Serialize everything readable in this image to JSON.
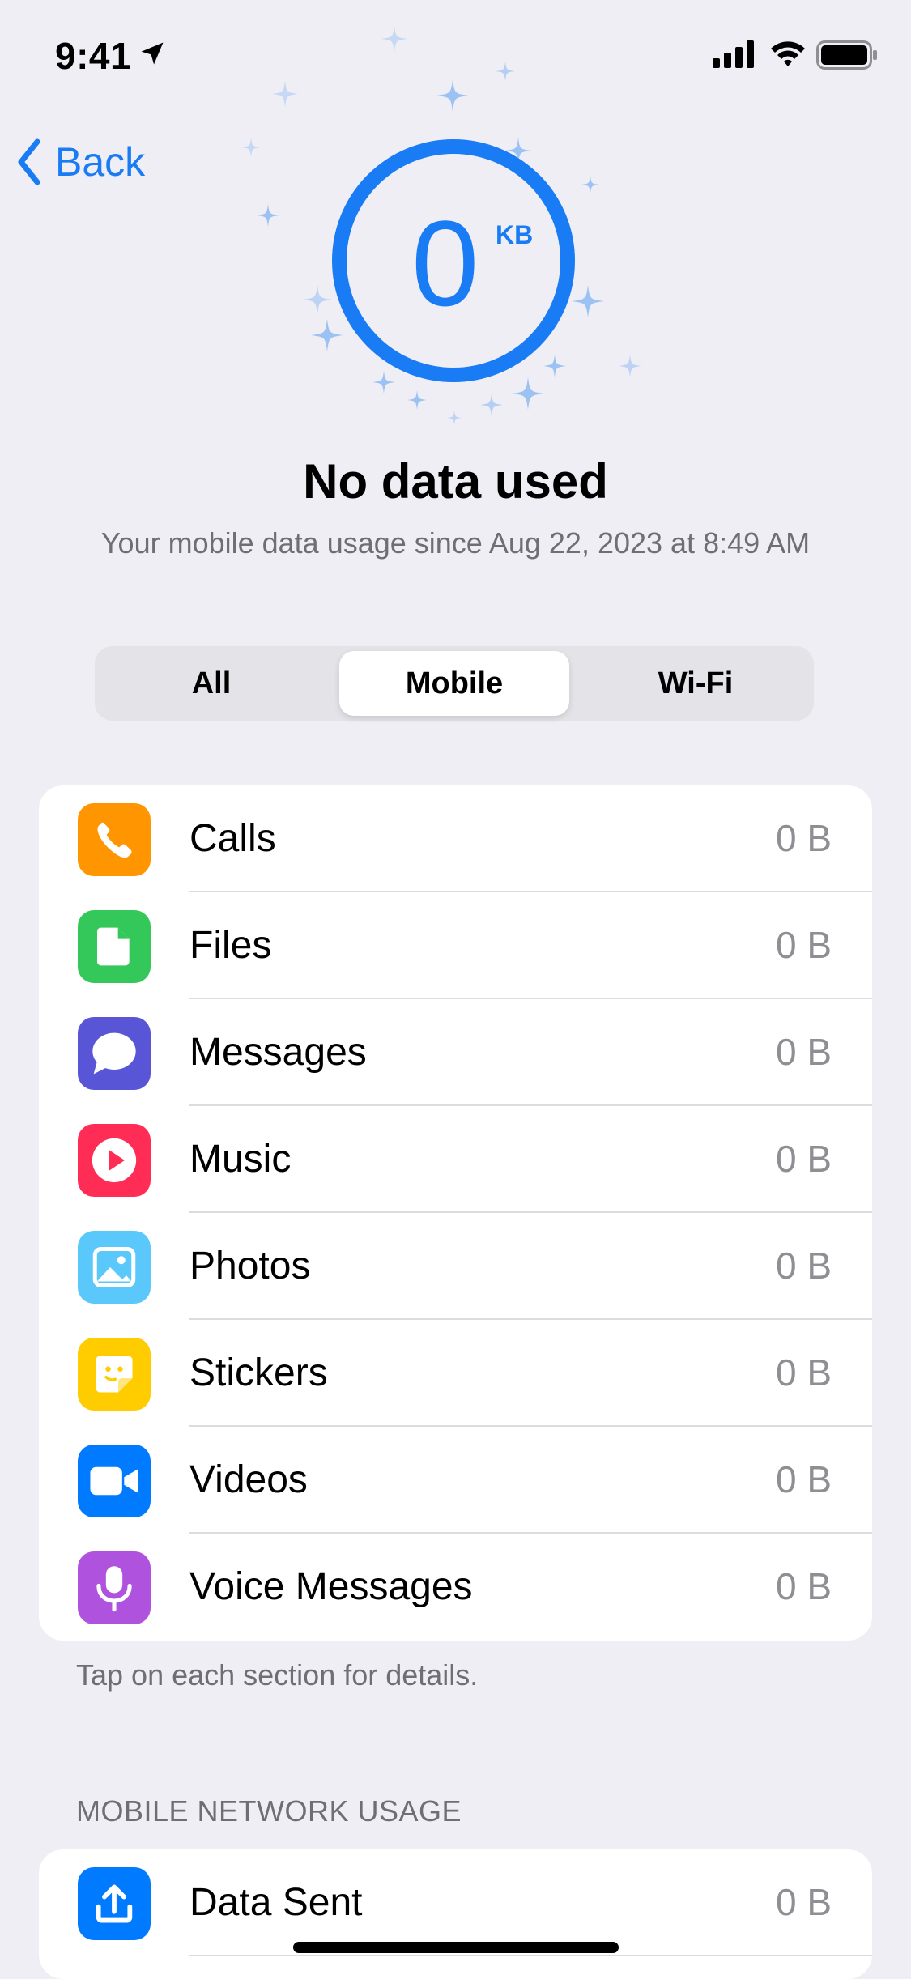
{
  "status_bar": {
    "time": "9:41"
  },
  "nav": {
    "back_label": "Back"
  },
  "usage": {
    "value": "0",
    "unit": "KB",
    "headline": "No data used",
    "subtitle": "Your mobile data usage since Aug 22, 2023 at 8:49 AM"
  },
  "segments": [
    {
      "label": "All",
      "selected": false
    },
    {
      "label": "Mobile",
      "selected": true
    },
    {
      "label": "Wi-Fi",
      "selected": false
    }
  ],
  "apps": [
    {
      "label": "Calls",
      "value": "0 B",
      "icon": "phone-icon",
      "color": "#ff9500"
    },
    {
      "label": "Files",
      "value": "0 B",
      "icon": "file-icon",
      "color": "#34c759"
    },
    {
      "label": "Messages",
      "value": "0 B",
      "icon": "speech-bubble-icon",
      "color": "#5856d6"
    },
    {
      "label": "Music",
      "value": "0 B",
      "icon": "play-icon",
      "color": "#ff2d55"
    },
    {
      "label": "Photos",
      "value": "0 B",
      "icon": "image-icon",
      "color": "#5ac8fa"
    },
    {
      "label": "Stickers",
      "value": "0 B",
      "icon": "sticker-icon",
      "color": "#ffcc00"
    },
    {
      "label": "Videos",
      "value": "0 B",
      "icon": "video-camera-icon",
      "color": "#007aff"
    },
    {
      "label": "Voice Messages",
      "value": "0 B",
      "icon": "microphone-icon",
      "color": "#af52de"
    }
  ],
  "footnote": "Tap on each section for details.",
  "network": {
    "header": "MOBILE NETWORK USAGE",
    "items": [
      {
        "label": "Data Sent",
        "value": "0 B",
        "icon": "upload-icon",
        "color": "#007aff"
      }
    ]
  },
  "accent_color": "#1a7cf5"
}
